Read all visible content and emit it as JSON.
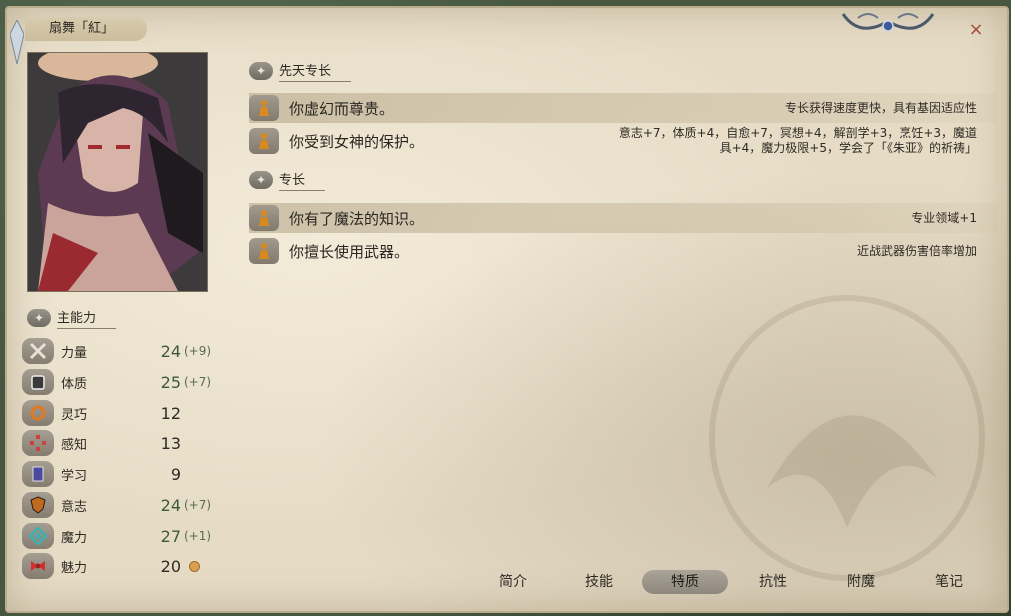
{
  "window": {
    "character_name": "扇舞「紅」",
    "close_label": "×"
  },
  "innate_section": {
    "title": "先天专长",
    "items": [
      {
        "name": "你虚幻而尊贵。",
        "desc": "专长获得速度更快，具有基因适应性",
        "highlight": true
      },
      {
        "name": "你受到女神的保护。",
        "desc": "意志+7，体质+4，自愈+7，冥想+4，解剖学+3，烹饪+3，魔道具+4，魔力极限+5，学会了「《朱亚》的祈祷」",
        "highlight": false
      }
    ]
  },
  "feats_section": {
    "title": "专长",
    "items": [
      {
        "name": "你有了魔法的知识。",
        "desc": "专业领域+1",
        "highlight": true
      },
      {
        "name": "你擅长使用武器。",
        "desc": "近战武器伤害倍率增加",
        "highlight": false
      }
    ]
  },
  "attributes": {
    "title": "主能力",
    "items": [
      {
        "icon": "swords-icon",
        "name": "力量",
        "value": "24",
        "bonus": "(+9)"
      },
      {
        "icon": "armor-icon",
        "name": "体质",
        "value": "25",
        "bonus": "(+7)"
      },
      {
        "icon": "ring-icon",
        "name": "灵巧",
        "value": "12",
        "bonus": ""
      },
      {
        "icon": "senses-icon",
        "name": "感知",
        "value": "13",
        "bonus": ""
      },
      {
        "icon": "book-icon",
        "name": "学习",
        "value": "9",
        "bonus": ""
      },
      {
        "icon": "shield-icon",
        "name": "意志",
        "value": "24",
        "bonus": "(+7)"
      },
      {
        "icon": "magic-icon",
        "name": "魔力",
        "value": "27",
        "bonus": "(+1)"
      },
      {
        "icon": "bow-icon",
        "name": "魅力",
        "value": "20",
        "bonus": ""
      }
    ]
  },
  "tabs": [
    {
      "label": "简介",
      "active": false
    },
    {
      "label": "技能",
      "active": false
    },
    {
      "label": "特质",
      "active": true
    },
    {
      "label": "抗性",
      "active": false
    },
    {
      "label": "附魔",
      "active": false
    },
    {
      "label": "笔记",
      "active": false
    }
  ],
  "colors": {
    "panel": "#e6dcc6",
    "accent_green": "#3e5a3a",
    "close": "#a04a3c"
  }
}
